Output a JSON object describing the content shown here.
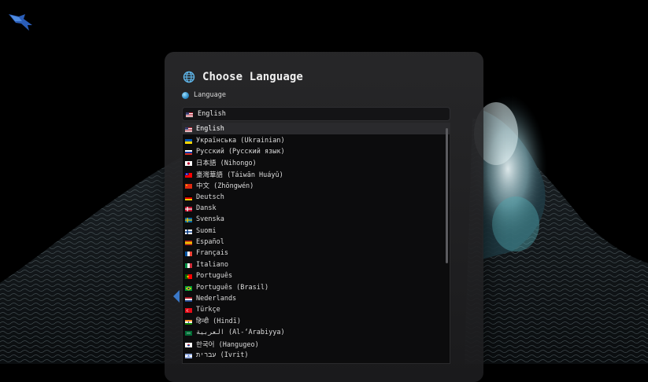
{
  "dialog": {
    "title": "Choose Language",
    "field_label": "Language",
    "selected_value": "English"
  },
  "languages": [
    {
      "label": "English",
      "flag": "us",
      "selected": true
    },
    {
      "label": "Українська (Ukrainian)",
      "flag": "ua"
    },
    {
      "label": "Русский (Русский язык)",
      "flag": "ru"
    },
    {
      "label": "日本語 (Nihongo)",
      "flag": "jp"
    },
    {
      "label": "臺灣華語 (Táiwān Huáyǔ)",
      "flag": "tw"
    },
    {
      "label": "中文 (Zhōngwén)",
      "flag": "cn"
    },
    {
      "label": "Deutsch",
      "flag": "de"
    },
    {
      "label": "Dansk",
      "flag": "dk"
    },
    {
      "label": "Svenska",
      "flag": "se"
    },
    {
      "label": "Suomi",
      "flag": "fi"
    },
    {
      "label": "Español",
      "flag": "es"
    },
    {
      "label": "Français",
      "flag": "fr"
    },
    {
      "label": "Italiano",
      "flag": "it"
    },
    {
      "label": "Português",
      "flag": "pt"
    },
    {
      "label": "Português (Brasil)",
      "flag": "br"
    },
    {
      "label": "Nederlands",
      "flag": "nl"
    },
    {
      "label": "Türkçe",
      "flag": "tr"
    },
    {
      "label": "हिन्दी (Hindī)",
      "flag": "in"
    },
    {
      "label": "العربية (Al-‘Arabiyya)",
      "flag": "sa"
    },
    {
      "label": "한국어 (Hangugeo)",
      "flag": "kr"
    },
    {
      "label": "עברית (Ivrit)",
      "flag": "il"
    }
  ],
  "colors": {
    "accent": "#3aa0e0",
    "card_bg": "#242426",
    "selected_bg": "#2a2a2d"
  }
}
